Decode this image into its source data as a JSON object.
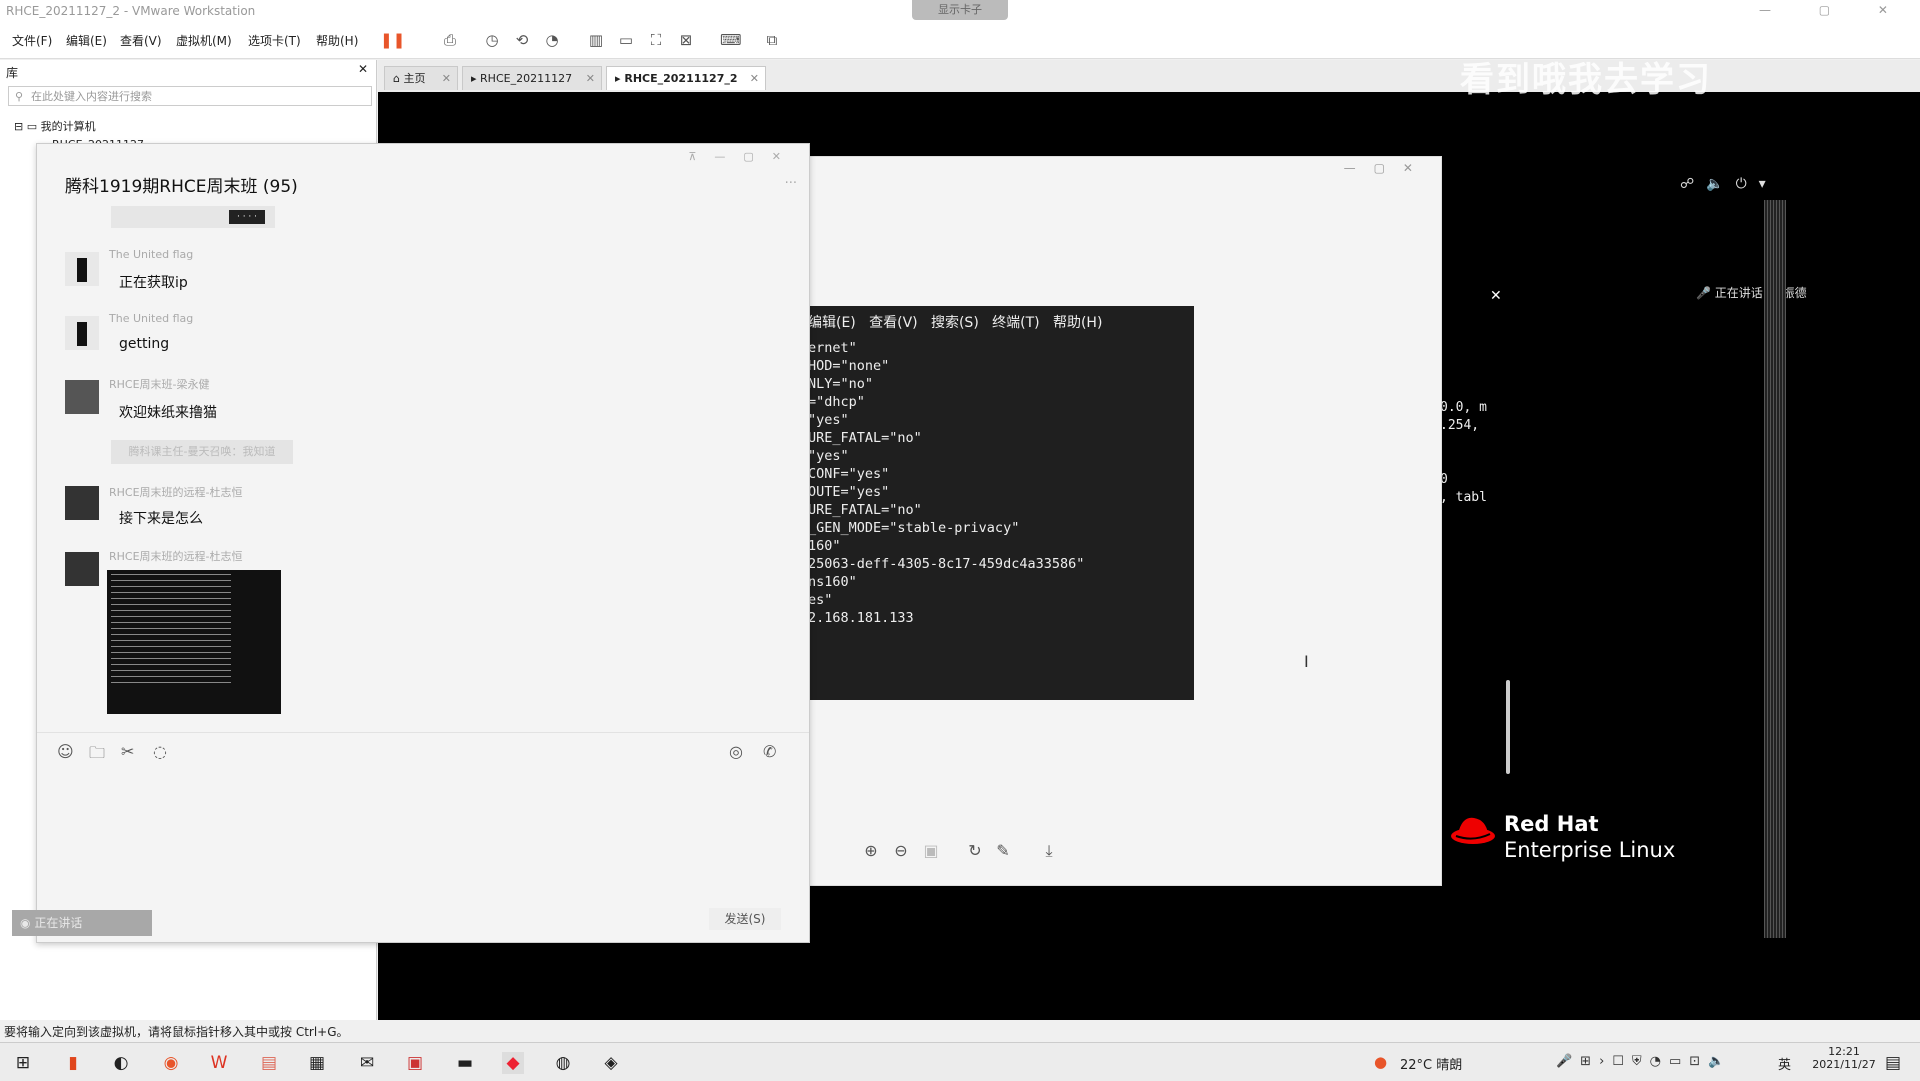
{
  "window": {
    "title": "RHCE_20211127_2 - VMware Workstation",
    "center_tab": "显示卡子"
  },
  "menu": [
    "文件(F)",
    "编辑(E)",
    "查看(V)",
    "虚拟机(M)",
    "选项卡(T)",
    "帮助(H)"
  ],
  "library": {
    "header": "库",
    "search_placeholder": "在此处键入内容进行搜索",
    "tree_root": "我的计算机",
    "tree_child": "RHCE_20211127"
  },
  "tabs": [
    {
      "label": "主页"
    },
    {
      "label": "RHCE_20211127"
    },
    {
      "label": "RHCE_20211127_2"
    }
  ],
  "watermark": "看到哦我去学习",
  "chat": {
    "title": "腾科1919期RHCE周末班 (95)",
    "top_badge": "· · · ·",
    "messages": [
      {
        "name": "The United flag",
        "text": "正在获取ip"
      },
      {
        "name": "The United flag",
        "text": "getting"
      },
      {
        "name": "RHCE周末班-梁永健",
        "text": "欢迎妹纸来撸猫"
      },
      {
        "name": "RHCE周末班的远程-杜志恒",
        "text": "接下来是怎么"
      },
      {
        "name": "RHCE周末班的远程-杜志恒",
        "text": ""
      }
    ],
    "system_notice": "腾科课主任-曼天召唤：我知道",
    "send_label": "发送(S)",
    "minimized_label": "正在讲话"
  },
  "terminal": {
    "menu": "编辑(E)   查看(V)   搜索(S)   终端(T)   帮助(H)",
    "lines": [
      "ernet\"",
      "HOD=\"none\"",
      "NLY=\"no\"",
      "=\"dhcp\"",
      "\"yes\"",
      "URE_FATAL=\"no\"",
      "\"yes\"",
      "CONF=\"yes\"",
      "OUTE=\"yes\"",
      "URE_FATAL=\"no\"",
      "_GEN_MODE=\"stable-privacy\"",
      "160\"",
      "25063-deff-4305-8c17-459dc4a33586\"",
      "ns160\"",
      "es\"",
      "2.168.181.133"
    ]
  },
  "rhel": {
    "lines": [
      "0.0, m",
      ".254, ",
      "0",
      ", tabl"
    ],
    "speaking": "正在讲话: 孙振德",
    "logo_line1": "Red Hat",
    "logo_line2": "Enterprise Linux"
  },
  "statusbar": {
    "text": "要将输入定向到该虚拟机，请将鼠标指针移入其中或按 Ctrl+G。"
  },
  "taskbar": {
    "weather": "22°C  晴朗",
    "time": "12:21",
    "date": "2021/11/27",
    "ime": "英"
  },
  "colors": {
    "accent_pause": "#e8552a",
    "rhel_red": "#ee0000"
  }
}
